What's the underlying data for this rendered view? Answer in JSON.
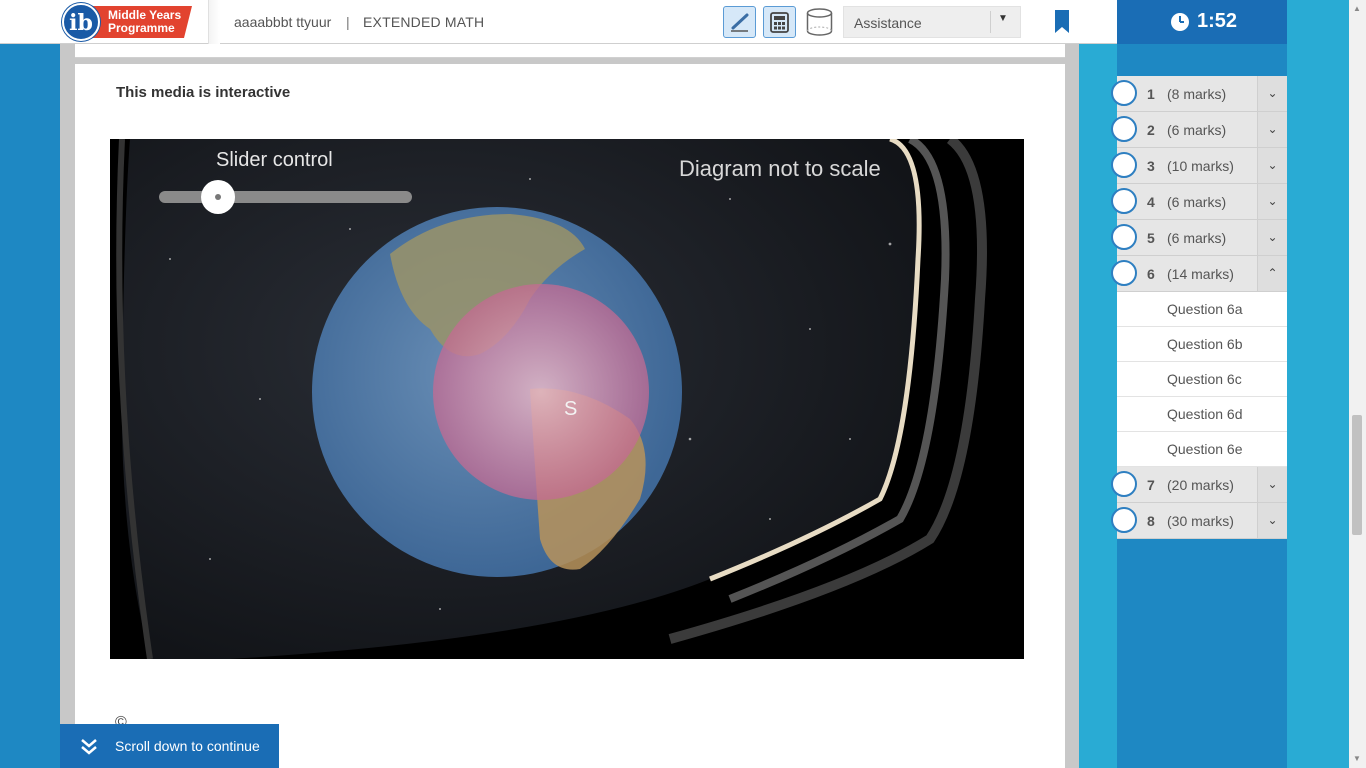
{
  "header": {
    "logo_ib": "ib",
    "logo_line1": "Middle Years",
    "logo_line2": "Programme",
    "user": "aaaabbbt ttyuur",
    "separator": "|",
    "subject": "EXTENDED MATH",
    "tools": [
      {
        "name": "pen-tool",
        "icon": "pen-icon",
        "active": true
      },
      {
        "name": "calculator-tool",
        "icon": "calculator-icon",
        "active": true
      },
      {
        "name": "3d-shape-tool",
        "icon": "cylinder-icon",
        "active": false
      }
    ],
    "assistance_label": "Assistance",
    "bookmark_icon": "bookmark-icon"
  },
  "timer": {
    "icon": "clock-icon",
    "time": "1:52"
  },
  "questions": [
    {
      "num": "1",
      "marks": "(8 marks)",
      "open": false
    },
    {
      "num": "2",
      "marks": "(6 marks)",
      "open": false
    },
    {
      "num": "3",
      "marks": "(10 marks)",
      "open": false
    },
    {
      "num": "4",
      "marks": "(6 marks)",
      "open": false
    },
    {
      "num": "5",
      "marks": "(6 marks)",
      "open": false
    },
    {
      "num": "6",
      "marks": "(14 marks)",
      "open": true,
      "subs": [
        "Question 6a",
        "Question 6b",
        "Question 6c",
        "Question 6d",
        "Question 6e"
      ]
    },
    {
      "num": "7",
      "marks": "(20 marks)",
      "open": false
    },
    {
      "num": "8",
      "marks": "(30 marks)",
      "open": false
    }
  ],
  "main": {
    "media_title": "This media is interactive",
    "slider_label": "Slider control",
    "slider_value": 0.22,
    "diagram_note": "Diagram not to scale",
    "point_label": "S",
    "copyright": "©"
  },
  "scroll_button": {
    "label": "Scroll down to continue",
    "icon": "double-chevron-down-icon"
  },
  "colors": {
    "brand_blue": "#1a6db5",
    "accent_red": "#e2432f",
    "panel_blue": "#29abd4"
  }
}
